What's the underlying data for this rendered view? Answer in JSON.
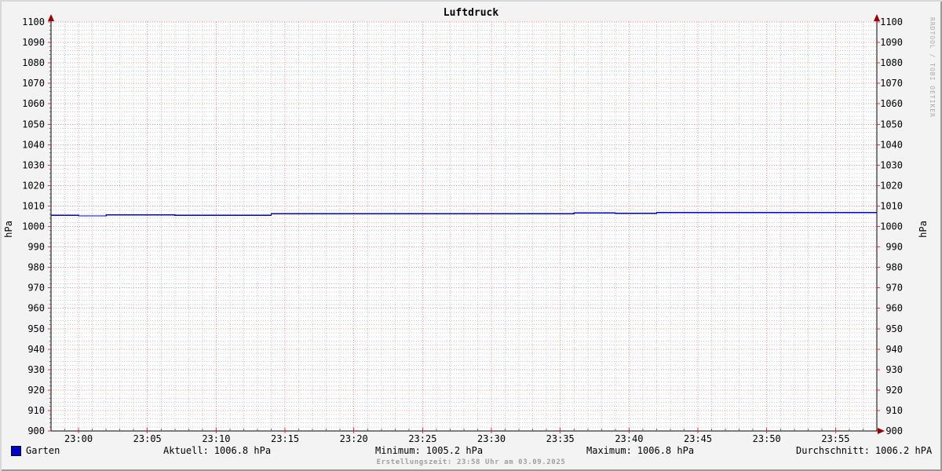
{
  "title": "Luftdruck",
  "y_axis_label_left": "hPa",
  "y_axis_label_right": "hPa",
  "watermark": "RRDTOOL / TOBI OETIKER",
  "legend": {
    "label": "Garten",
    "color": "#0000cc"
  },
  "stats_row": [
    {
      "label": "Aktuell:",
      "value": "1006.8 hPa"
    },
    {
      "label": "Minimum:",
      "value": "1005.2 hPa"
    },
    {
      "label": "Maximum:",
      "value": "1006.8 hPa"
    },
    {
      "label": "Durchschnitt:",
      "value": "1006.2 hPA"
    }
  ],
  "footer": "Erstellungszeit: 23:58 Uhr am 03.09.2025",
  "colors": {
    "line": "#0000cc",
    "grid_major": "#ff0000",
    "grid_minor": "#c5cad2",
    "axis": "#000000",
    "arrow": "#990000",
    "background": "#f3f3f3",
    "canvas": "#ffffff",
    "watermark_text": "#aaaaaa"
  },
  "chart_data": {
    "type": "line",
    "title": "Luftdruck",
    "ylabel": "hPa",
    "ylim": [
      900,
      1100
    ],
    "y_ticks": [
      900,
      910,
      920,
      930,
      940,
      950,
      960,
      970,
      980,
      990,
      1000,
      1010,
      1020,
      1030,
      1040,
      1050,
      1060,
      1070,
      1080,
      1090,
      1100
    ],
    "y_major_step": 10,
    "y_minor_step": 2,
    "x_start": "22:58",
    "x_end": "23:58",
    "x_major_labels": [
      "23:00",
      "23:05",
      "23:10",
      "23:15",
      "23:20",
      "23:25",
      "23:30",
      "23:35",
      "23:40",
      "23:45",
      "23:50",
      "23:55"
    ],
    "x_major_step_min": 5,
    "x_minor_step_min": 1,
    "grid": true,
    "legend_position": "bottom-left",
    "series": [
      {
        "name": "Garten",
        "color": "#0000cc",
        "unit": "hPa",
        "steps": [
          {
            "t": "22:58",
            "v": 1005.4
          },
          {
            "t": "23:00",
            "v": 1005.2
          },
          {
            "t": "23:02",
            "v": 1005.6
          },
          {
            "t": "23:07",
            "v": 1005.5
          },
          {
            "t": "23:14",
            "v": 1006.2
          },
          {
            "t": "23:24",
            "v": 1006.3
          },
          {
            "t": "23:36",
            "v": 1006.6
          },
          {
            "t": "23:39",
            "v": 1006.4
          },
          {
            "t": "23:42",
            "v": 1006.8
          },
          {
            "t": "23:58",
            "v": 1006.8
          }
        ]
      }
    ],
    "stats": {
      "aktuell": 1006.8,
      "minimum": 1005.2,
      "maximum": 1006.8,
      "durchschnitt": 1006.2
    }
  }
}
